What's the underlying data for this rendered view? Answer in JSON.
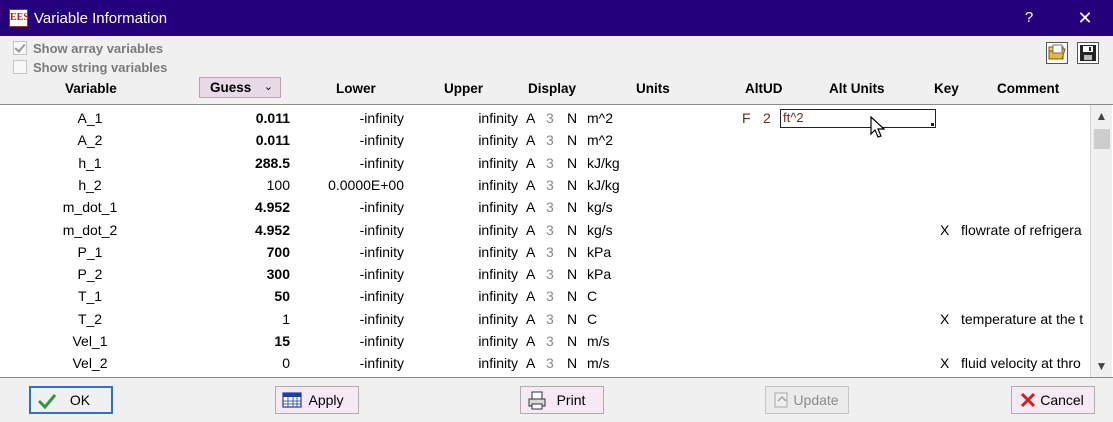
{
  "window": {
    "title": "Variable Information",
    "icon_text": "EES",
    "help_glyph": "?",
    "close_glyph": "✕"
  },
  "options": {
    "show_array": {
      "label": "Show array variables",
      "checked": true
    },
    "show_string": {
      "label": "Show string variables",
      "checked": false
    }
  },
  "toolbar": {
    "open_icon": "folder-open-icon",
    "save_icon": "floppy-disk-icon"
  },
  "columns": {
    "variable": "Variable",
    "guess": "Guess",
    "lower": "Lower",
    "upper": "Upper",
    "display": "Display",
    "units": "Units",
    "altud": "AltUD",
    "alt_units": "Alt Units",
    "key": "Key",
    "comment": "Comment"
  },
  "rows": [
    {
      "var": "A_1",
      "guess": "0.011",
      "bold": true,
      "lower": "-infinity",
      "upper": "infinity",
      "fmt": "A",
      "digits": "3",
      "style": "N",
      "units": "m^2",
      "altud": "F",
      "alt2": "2",
      "alt_units": "ft^2",
      "key": "",
      "comment": ""
    },
    {
      "var": "A_2",
      "guess": "0.011",
      "bold": true,
      "lower": "-infinity",
      "upper": "infinity",
      "fmt": "A",
      "digits": "3",
      "style": "N",
      "units": "m^2",
      "altud": "",
      "alt2": "",
      "alt_units": "",
      "key": "",
      "comment": ""
    },
    {
      "var": "h_1",
      "guess": "288.5",
      "bold": true,
      "lower": "-infinity",
      "upper": "infinity",
      "fmt": "A",
      "digits": "3",
      "style": "N",
      "units": "kJ/kg",
      "altud": "",
      "alt2": "",
      "alt_units": "",
      "key": "",
      "comment": ""
    },
    {
      "var": "h_2",
      "guess": "100",
      "bold": false,
      "lower": "0.0000E+00",
      "upper": "infinity",
      "fmt": "A",
      "digits": "3",
      "style": "N",
      "units": "kJ/kg",
      "altud": "",
      "alt2": "",
      "alt_units": "",
      "key": "",
      "comment": ""
    },
    {
      "var": "m_dot_1",
      "guess": "4.952",
      "bold": true,
      "lower": "-infinity",
      "upper": "infinity",
      "fmt": "A",
      "digits": "3",
      "style": "N",
      "units": "kg/s",
      "altud": "",
      "alt2": "",
      "alt_units": "",
      "key": "",
      "comment": ""
    },
    {
      "var": "m_dot_2",
      "guess": "4.952",
      "bold": true,
      "lower": "-infinity",
      "upper": "infinity",
      "fmt": "A",
      "digits": "3",
      "style": "N",
      "units": "kg/s",
      "altud": "",
      "alt2": "",
      "alt_units": "",
      "key": "X",
      "comment": "flowrate of refrigera"
    },
    {
      "var": "P_1",
      "guess": "700",
      "bold": true,
      "lower": "-infinity",
      "upper": "infinity",
      "fmt": "A",
      "digits": "3",
      "style": "N",
      "units": "kPa",
      "altud": "",
      "alt2": "",
      "alt_units": "",
      "key": "",
      "comment": ""
    },
    {
      "var": "P_2",
      "guess": "300",
      "bold": true,
      "lower": "-infinity",
      "upper": "infinity",
      "fmt": "A",
      "digits": "3",
      "style": "N",
      "units": "kPa",
      "altud": "",
      "alt2": "",
      "alt_units": "",
      "key": "",
      "comment": ""
    },
    {
      "var": "T_1",
      "guess": "50",
      "bold": true,
      "lower": "-infinity",
      "upper": "infinity",
      "fmt": "A",
      "digits": "3",
      "style": "N",
      "units": "C",
      "altud": "",
      "alt2": "",
      "alt_units": "",
      "key": "",
      "comment": ""
    },
    {
      "var": "T_2",
      "guess": "1",
      "bold": false,
      "lower": "-infinity",
      "upper": "infinity",
      "fmt": "A",
      "digits": "3",
      "style": "N",
      "units": "C",
      "altud": "",
      "alt2": "",
      "alt_units": "",
      "key": "X",
      "comment": "temperature at the t"
    },
    {
      "var": "Vel_1",
      "guess": "15",
      "bold": true,
      "lower": "-infinity",
      "upper": "infinity",
      "fmt": "A",
      "digits": "3",
      "style": "N",
      "units": "m/s",
      "altud": "",
      "alt2": "",
      "alt_units": "",
      "key": "",
      "comment": ""
    },
    {
      "var": "Vel_2",
      "guess": "0",
      "bold": false,
      "lower": "-infinity",
      "upper": "infinity",
      "fmt": "A",
      "digits": "3",
      "style": "N",
      "units": "m/s",
      "altud": "",
      "alt2": "",
      "alt_units": "",
      "key": "X",
      "comment": "fluid velocity at thro"
    }
  ],
  "scrollbar": {
    "up_glyph": "▲",
    "down_glyph": "▼"
  },
  "buttons": {
    "ok": "OK",
    "apply": "Apply",
    "print": "Print",
    "update": "Update",
    "cancel": "Cancel"
  },
  "colors": {
    "titlebar": "#24007a",
    "button_face": "#f5e9f4",
    "altud_text": "#6b2a20",
    "ok_icon": "#2e9a3a",
    "cancel_icon": "#d1201c"
  }
}
